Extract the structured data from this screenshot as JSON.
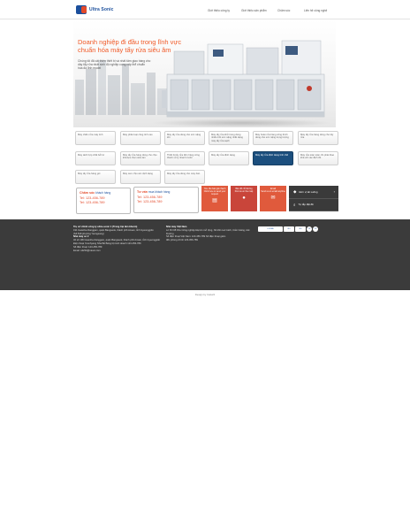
{
  "header": {
    "logo_text": "Ultra Sonic",
    "nav": [
      "Giới thiệu công ty",
      "Giới thiệu sản phẩm",
      "Chăm sóc",
      "Liên hệ công nghệ"
    ]
  },
  "hero": {
    "title_line1": "Doanh nghiệp đi đầu trong lĩnh vực",
    "title_line2": "chuẩn hóa máy tẩy rửa siêu âm",
    "sub_line1": "Chúng tôi đã cải thiện thiết bị và nhất tâm giao hàng cho",
    "sub_line2": "dây tẩy rửa nhất sinh độ nghiệp cung cấp thể chuẩn",
    "sub_line3": "hóa đa lĩnh model"
  },
  "products": [
    "Máy chấm rửa máy tính",
    "Máy phân loại công tính cao",
    "Máy tẩy rửa dùng cho sức nặng lớn",
    "Máy tẩy rửa khử trùng dùng nhiều bởi sức nặng nhất dạng máy tẩy rửa sạch",
    "Máy hoàn rửa hàng công thích dùng cho sức nặng trọng lượng",
    "Máy tẩy rửa hàng dùng cho tẩy rửa",
    "Máy tách hợp chất bởi từ",
    "Máy tẩy rửa hàng dùng cho chịu khả lựa chọn siêu âm",
    "Thiết bị tẩy rửa đơn hàng công thành xử lý nhanh trước",
    "Máy tẩy rửa định dạng",
    "Máy tẩy rửa định dạng tinh chế",
    "Máy rửa toàn toàn chi phát thao khả với xác định tốt",
    "Máy tẩy rửa hàng gói",
    "Máy xem chịu sóc dịch dạng",
    "Máy tẩy rửa dùng cho máy bán"
  ],
  "contacts": [
    {
      "title_a": "Chăm sóc",
      "title_b": "khách hàng",
      "phone1": "Tel: 123-456-789",
      "phone2": "Tel: 123-456-789"
    },
    {
      "title_a": "Tư vấn",
      "title_b": "mua khách hàng",
      "phone1": "Tel: 123-456-789",
      "phone2": "Tel: 123-456-789"
    }
  ],
  "quick": [
    {
      "label": "Yêu cầu báo giá nhanh",
      "sub": "Click here to send your request",
      "icon": "document-icon"
    },
    {
      "label": "Bản đồ chỉ đường",
      "sub": "Find us on the map",
      "icon": "map-pin-icon"
    },
    {
      "label": "Email",
      "sub": "Send us an email anytime",
      "icon": "envelope-icon"
    }
  ],
  "side": {
    "catalog": "Đơn vị tải xuống",
    "search": "Tự lắp đặt đề"
  },
  "footer": {
    "hq_name": "Trụ sở chính công ty ultra-sonic 1 (Trang trại làm khuôn)",
    "hq_addr": "191 Gwanhe-Danggam, quận Bangseok, thành phố Ansan, tỉnh Gyeonggido",
    "hq_addr2": "(Số 549 phường Yeongsang)",
    "plant2_label": "Nhà máy số 2",
    "plant2_addr": "32 số 196 Gwanhe-Danggam, quận Bangseok, thành phố Ansan, tỉnh Gyeonggido",
    "plant2_phone": "Điện thoại Yeonhyang Nhà Bể Bảng bộ kinh doanh 123-456-789",
    "plant2_phone2": "Số điện thoại: 123-456-789",
    "email": "Email: ult234@naver.com",
    "vn_label": "Nhà máy Việt Nam",
    "vn_addr": "Lô XN 08 Khu Công nghiệp Đại An mở rộng, Xã trần Lai Cách, Cẩm Giàng, Hải Dương",
    "vn_phone": "Số điện thoại Việt Nam: 123-456-789 Số điện thoại giám",
    "vn_phone2": "đốc phòng chính 123-456-789",
    "certs": [
      "KOREA",
      "ISO",
      "ISO",
      "CE",
      "CE"
    ]
  },
  "design_credit": "Design by Cafe24"
}
